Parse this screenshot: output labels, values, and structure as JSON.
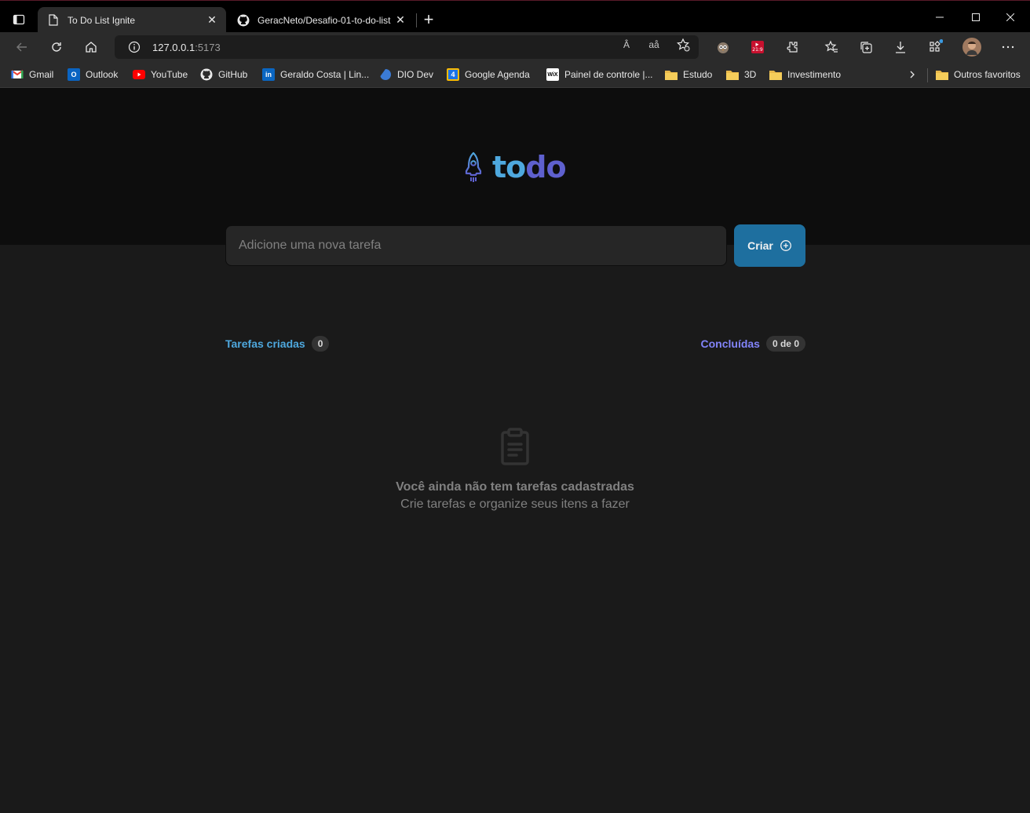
{
  "browser": {
    "tabs": [
      {
        "title": "To Do List Ignite",
        "active": true
      },
      {
        "title": "GeracNeto/Desafio-01-to-do-list",
        "active": false
      }
    ],
    "address": {
      "host": "127.0.0.1",
      "port": ":5173"
    },
    "read_aloud_label": "Â",
    "translate_label": "aå",
    "extension_badge": "21:9",
    "bookmarks": [
      {
        "label": "Gmail",
        "icon": "gmail-icon"
      },
      {
        "label": "Outlook",
        "icon": "outlook-icon"
      },
      {
        "label": "YouTube",
        "icon": "youtube-icon"
      },
      {
        "label": "GitHub",
        "icon": "github-icon"
      },
      {
        "label": "Geraldo Costa | Lin...",
        "icon": "linkedin-icon"
      },
      {
        "label": "DIO Dev",
        "icon": "dio-icon"
      },
      {
        "label": "Google Agenda",
        "icon": "calendar-icon"
      },
      {
        "label": "Painel de controle |...",
        "icon": "wix-icon"
      },
      {
        "label": "Estudo",
        "icon": "folder-icon"
      },
      {
        "label": "3D",
        "icon": "folder-icon"
      },
      {
        "label": "Investimento",
        "icon": "folder-icon"
      }
    ],
    "other_favorites": "Outros favoritos",
    "icon_text": {
      "outlook": "O",
      "linkedin": "in",
      "calendar": "4",
      "wix": "WiX"
    }
  },
  "app": {
    "logo": {
      "part1": "to",
      "part2": "do"
    },
    "input_placeholder": "Adicione uma nova tarefa",
    "create_label": "Criar",
    "created_label": "Tarefas criadas",
    "created_count": "0",
    "done_label": "Concluídas",
    "done_count": "0 de 0",
    "empty_title": "Você ainda não tem tarefas cadastradas",
    "empty_subtitle": "Crie tarefas e organize seus itens a fazer"
  },
  "colors": {
    "blue": "#4ea8de",
    "purple": "#5e60ce",
    "purple_light": "#8284fa",
    "button": "#1e6f9f"
  }
}
